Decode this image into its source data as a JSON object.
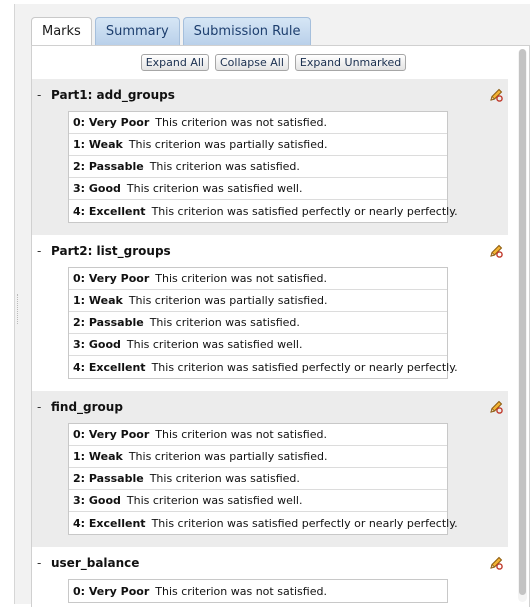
{
  "tabs": [
    "Marks",
    "Summary",
    "Submission Rule"
  ],
  "actions": {
    "expand_all": "Expand All",
    "collapse_all": "Collapse All",
    "expand_unmarked": "Expand Unmarked"
  },
  "icons": {
    "toggle": "minus-icon",
    "edit": "pencil-edit-icon"
  },
  "colors": {
    "tab_blue": "#b9d0ea",
    "criterion_bg": "#ececec"
  },
  "criteria": [
    {
      "toggle": "-",
      "name": "Part1: add_groups",
      "levels": [
        {
          "name": "0: Very Poor",
          "desc": "This criterion was not satisfied."
        },
        {
          "name": "1: Weak",
          "desc": "This criterion was partially satisfied."
        },
        {
          "name": "2: Passable",
          "desc": "This criterion was satisfied."
        },
        {
          "name": "3: Good",
          "desc": "This criterion was satisfied well."
        },
        {
          "name": "4: Excellent",
          "desc": "This criterion was satisfied perfectly or nearly perfectly."
        }
      ]
    },
    {
      "toggle": "-",
      "name": "Part2: list_groups",
      "levels": [
        {
          "name": "0: Very Poor",
          "desc": "This criterion was not satisfied."
        },
        {
          "name": "1: Weak",
          "desc": "This criterion was partially satisfied."
        },
        {
          "name": "2: Passable",
          "desc": "This criterion was satisfied."
        },
        {
          "name": "3: Good",
          "desc": "This criterion was satisfied well."
        },
        {
          "name": "4: Excellent",
          "desc": "This criterion was satisfied perfectly or nearly perfectly."
        }
      ]
    },
    {
      "toggle": "-",
      "name": "find_group",
      "levels": [
        {
          "name": "0: Very Poor",
          "desc": "This criterion was not satisfied."
        },
        {
          "name": "1: Weak",
          "desc": "This criterion was partially satisfied."
        },
        {
          "name": "2: Passable",
          "desc": "This criterion was satisfied."
        },
        {
          "name": "3: Good",
          "desc": "This criterion was satisfied well."
        },
        {
          "name": "4: Excellent",
          "desc": "This criterion was satisfied perfectly or nearly perfectly."
        }
      ]
    },
    {
      "toggle": "-",
      "name": "user_balance",
      "levels": [
        {
          "name": "0: Very Poor",
          "desc": "This criterion was not satisfied."
        }
      ]
    }
  ]
}
